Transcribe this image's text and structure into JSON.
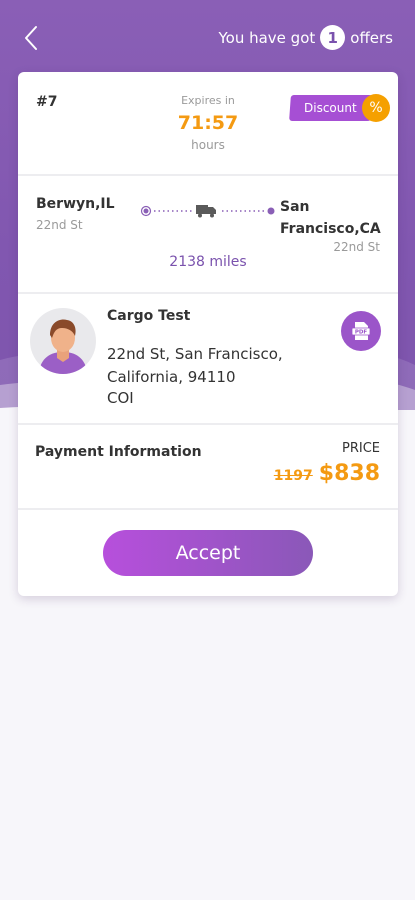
{
  "header": {
    "offers_prefix": "You have got",
    "offers_count": "1",
    "offers_suffix": "offers"
  },
  "offer": {
    "id": "#7",
    "expires_label": "Expires in",
    "expires_time": "71:57",
    "expires_unit": "hours",
    "discount_label": "Discount",
    "discount_icon": "%"
  },
  "route": {
    "from_city": "Berwyn,IL",
    "from_street": "22nd St",
    "to_city": "San Francisco,CA",
    "to_street": "22nd St",
    "distance": "2138 miles",
    "truck_icon": "truck-icon"
  },
  "shipper": {
    "name": "Cargo Test",
    "address": "22nd St,  San Francisco, California, 94110",
    "doc_label": "COI",
    "pdf_icon": "pdf-icon"
  },
  "payment": {
    "label": "Payment Information",
    "price_label": "PRICE",
    "old_price": "1197",
    "new_price": "$838"
  },
  "actions": {
    "accept_label": "Accept"
  },
  "colors": {
    "primary": "#8157b0",
    "accent": "#f49a12",
    "discount": "#a64fd4"
  }
}
